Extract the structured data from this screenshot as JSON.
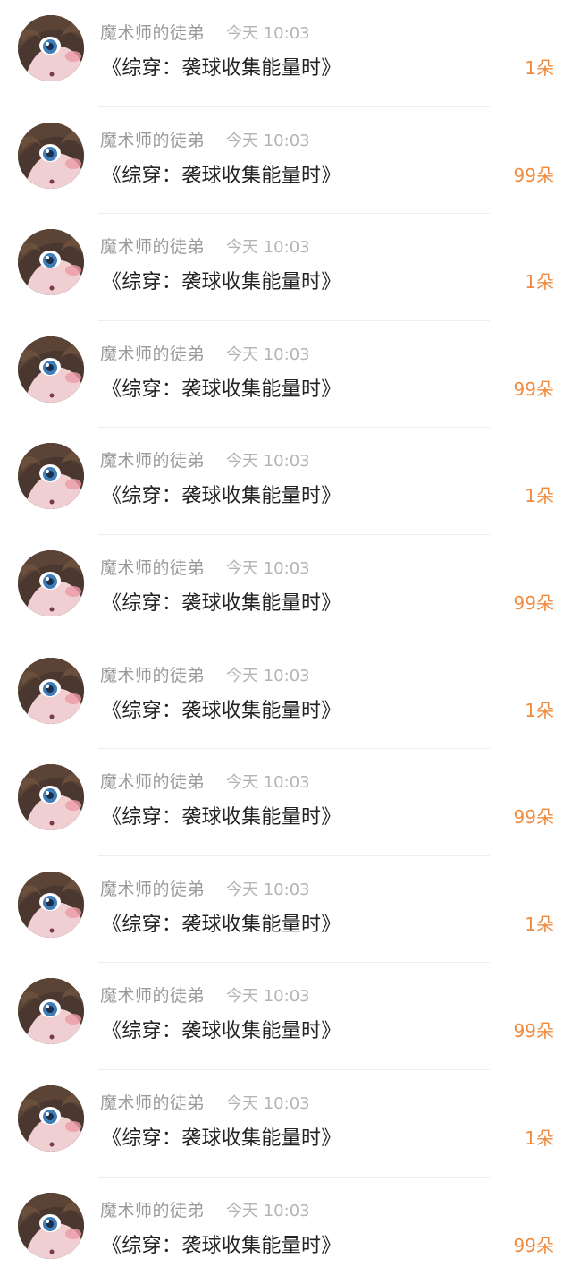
{
  "messages": [
    {
      "user": "魔术师的徒弟",
      "time": "今天 10:03",
      "title": "《综穿：袭球收集能量时》",
      "gift": "1朵"
    },
    {
      "user": "魔术师的徒弟",
      "time": "今天 10:03",
      "title": "《综穿：袭球收集能量时》",
      "gift": "99朵"
    },
    {
      "user": "魔术师的徒弟",
      "time": "今天 10:03",
      "title": "《综穿：袭球收集能量时》",
      "gift": "1朵"
    },
    {
      "user": "魔术师的徒弟",
      "time": "今天 10:03",
      "title": "《综穿：袭球收集能量时》",
      "gift": "99朵"
    },
    {
      "user": "魔术师的徒弟",
      "time": "今天 10:03",
      "title": "《综穿：袭球收集能量时》",
      "gift": "1朵"
    },
    {
      "user": "魔术师的徒弟",
      "time": "今天 10:03",
      "title": "《综穿：袭球收集能量时》",
      "gift": "99朵"
    },
    {
      "user": "魔术师的徒弟",
      "time": "今天 10:03",
      "title": "《综穿：袭球收集能量时》",
      "gift": "1朵"
    },
    {
      "user": "魔术师的徒弟",
      "time": "今天 10:03",
      "title": "《综穿：袭球收集能量时》",
      "gift": "99朵"
    },
    {
      "user": "魔术师的徒弟",
      "time": "今天 10:03",
      "title": "《综穿：袭球收集能量时》",
      "gift": "1朵"
    },
    {
      "user": "魔术师的徒弟",
      "time": "今天 10:03",
      "title": "《综穿：袭球收集能量时》",
      "gift": "99朵"
    },
    {
      "user": "魔术师的徒弟",
      "time": "今天 10:03",
      "title": "《综穿：袭球收集能量时》",
      "gift": "1朵"
    },
    {
      "user": "魔术师的徒弟",
      "time": "今天 10:03",
      "title": "《综穿：袭球收集能量时》",
      "gift": "99朵"
    }
  ],
  "colors": {
    "gift_accent": "#f08a3e",
    "username": "#9a9a9a",
    "timestamp": "#b4b4b4",
    "title_text": "#222222"
  },
  "icons": {
    "avatar": "anime-girl-avatar-icon"
  }
}
